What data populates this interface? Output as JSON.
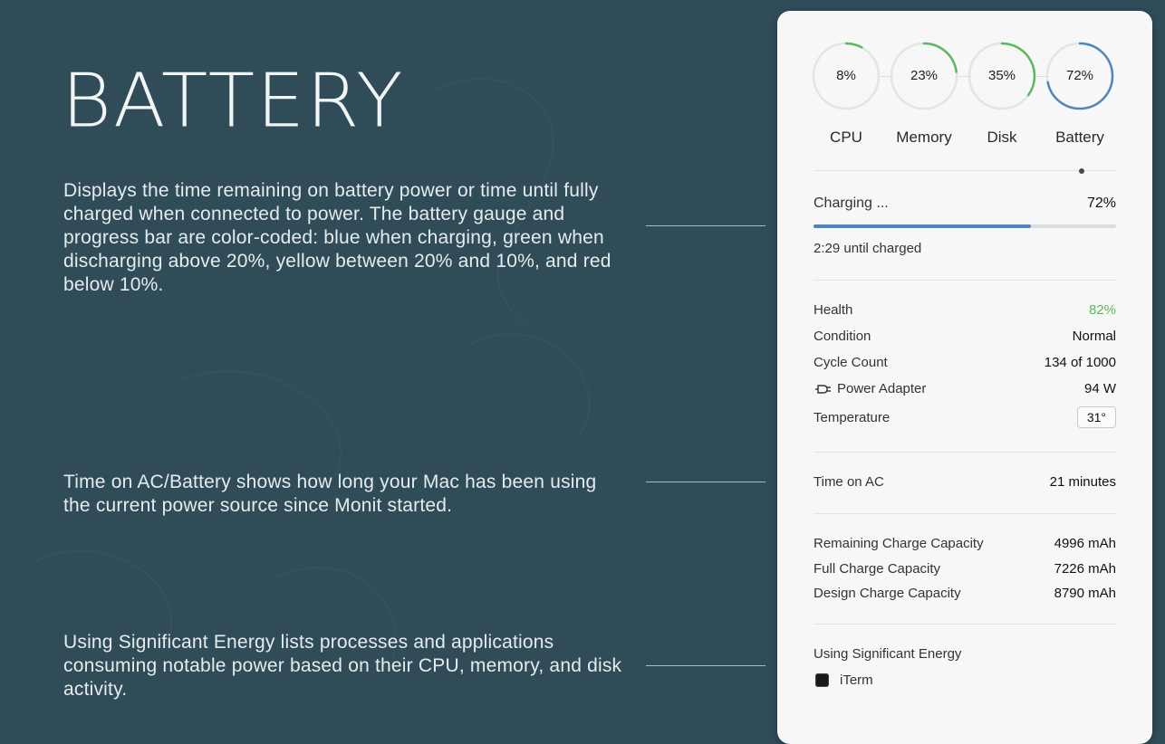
{
  "intro": {
    "title": "BATTERY",
    "desc1": "Displays the time remaining on battery power or time until fully charged when connected to power. The battery gauge and progress bar are color-coded: blue when charging, green when discharging above 20%, yellow between 20% and 10%, and red below 10%.",
    "desc2": "Time on AC/Battery shows how long your Mac has been using the current power source since Monit started.",
    "desc3": "Using Significant Energy lists processes and applications consuming notable power based on their CPU, memory, and disk activity."
  },
  "gauges": [
    {
      "value": "8%",
      "label": "CPU",
      "fraction": 0.08,
      "color": "#5cb85c"
    },
    {
      "value": "23%",
      "label": "Memory",
      "fraction": 0.23,
      "color": "#5cb85c"
    },
    {
      "value": "35%",
      "label": "Disk",
      "fraction": 0.35,
      "color": "#5cb85c"
    },
    {
      "value": "72%",
      "label": "Battery",
      "fraction": 0.72,
      "color": "#4d86bd"
    }
  ],
  "status": {
    "state": "Charging ...",
    "percent": "72%",
    "progress": 0.72,
    "time_remaining": "2:29 until charged"
  },
  "details": {
    "health_label": "Health",
    "health_value": "82%",
    "condition_label": "Condition",
    "condition_value": "Normal",
    "cycle_label": "Cycle Count",
    "cycle_value": "134 of 1000",
    "adapter_label": "Power Adapter",
    "adapter_value": "94 W",
    "temp_label": "Temperature",
    "temp_value": "31°"
  },
  "time_on": {
    "label": "Time on AC",
    "value": "21 minutes"
  },
  "capacity": {
    "remaining_label": "Remaining Charge Capacity",
    "remaining_value": "4996 mAh",
    "full_label": "Full Charge Capacity",
    "full_value": "7226 mAh",
    "design_label": "Design Charge Capacity",
    "design_value": "8790 mAh"
  },
  "energy": {
    "label": "Using Significant Energy",
    "apps": [
      "iTerm"
    ]
  },
  "colors": {
    "background": "#2f4c58",
    "panel": "#f7f7f7",
    "charging_blue": "#4d86bd",
    "health_green": "#5cb85c"
  }
}
